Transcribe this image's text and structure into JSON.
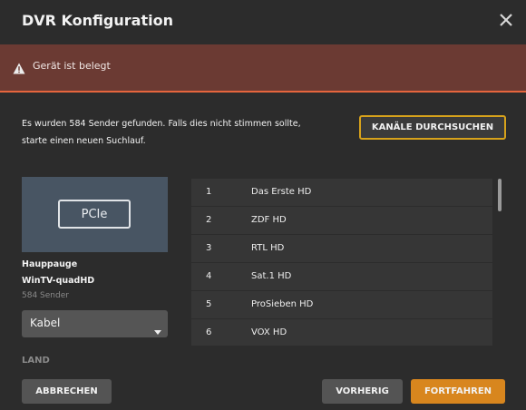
{
  "header": {
    "title": "DVR Konfiguration",
    "close_icon": "close-icon"
  },
  "alert": {
    "icon": "warning-icon",
    "text": "Gerät ist belegt",
    "background": "#6b3a33",
    "accent": "#e5653d"
  },
  "scan": {
    "message_line1": "Es wurden 584 Sender gefunden. Falls dies nicht stimmen sollte,",
    "message_line2": "starte einen neuen Suchlauf.",
    "button_label": "KANÄLE DURCHSUCHEN"
  },
  "device": {
    "badge": "PCIe",
    "brand": "Hauppauge",
    "model": "WinTV-quadHD",
    "channel_count": "584 Sender"
  },
  "source_select": {
    "value": "Kabel",
    "icon": "caret-down-icon"
  },
  "country": {
    "label": "LAND"
  },
  "channels": [
    {
      "number": "1",
      "name": "Das Erste HD"
    },
    {
      "number": "2",
      "name": "ZDF HD"
    },
    {
      "number": "3",
      "name": "RTL HD"
    },
    {
      "number": "4",
      "name": "Sat.1 HD"
    },
    {
      "number": "5",
      "name": "ProSieben HD"
    },
    {
      "number": "6",
      "name": "VOX HD"
    }
  ],
  "footer": {
    "cancel_label": "ABBRECHEN",
    "prev_label": "VORHERIG",
    "next_label": "FORTFAHREN",
    "primary_color": "#d8861e"
  }
}
